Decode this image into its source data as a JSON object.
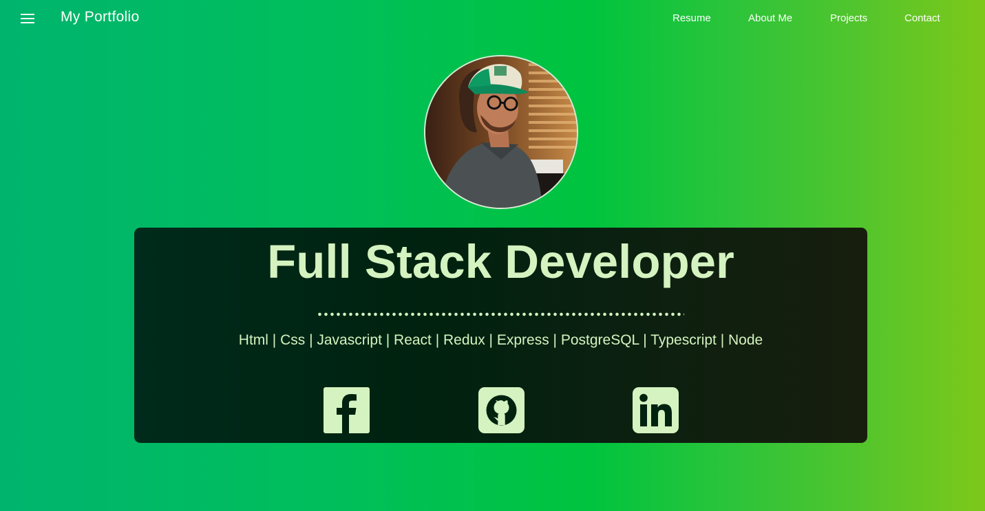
{
  "nav": {
    "brand": "My Portfolio",
    "menu_icon": "hamburger-menu-icon",
    "links": [
      "Resume",
      "About Me",
      "Projects",
      "Contact"
    ]
  },
  "profile": {
    "photo": "profile-photo"
  },
  "hero": {
    "title": "Full Stack Developer",
    "skills": "Html | Css | Javascript | React | Redux | Express | PostgreSQL | Typescript | Node"
  },
  "social": [
    {
      "icon": "facebook-icon"
    },
    {
      "icon": "github-icon"
    },
    {
      "icon": "linkedin-icon"
    }
  ],
  "colors": {
    "accent_text": "#d4f3c0",
    "nav_text": "#ffffff",
    "gradient_left": "#00b46e",
    "gradient_right": "#7ec819",
    "card_background": "#00220f"
  }
}
